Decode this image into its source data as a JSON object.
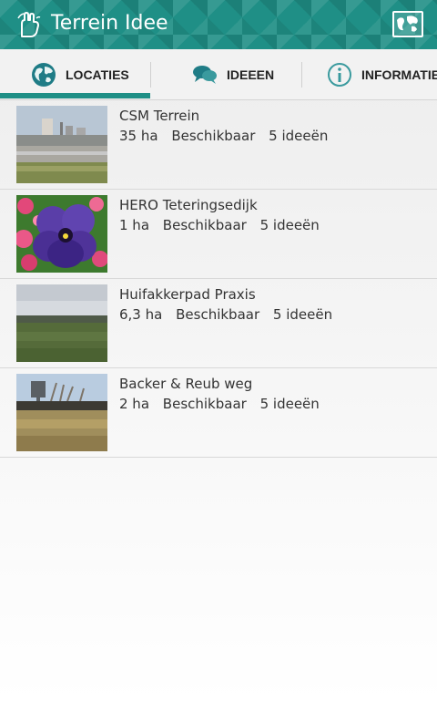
{
  "app": {
    "title": "Terrein Idee"
  },
  "icons": {
    "app": "hand-icon",
    "map": "map-icon",
    "locaties": "globe-icon",
    "ideeen": "chat-bubbles-icon",
    "informatie": "info-icon"
  },
  "tabs": [
    {
      "label": "LOCATIES",
      "active": true
    },
    {
      "label": "IDEEEN",
      "active": false
    },
    {
      "label": "INFORMATIE",
      "active": false
    }
  ],
  "locations": [
    {
      "name": "CSM Terrein",
      "size": "35 ha",
      "status": "Beschikbaar",
      "ideas": "5 ideeën"
    },
    {
      "name": "HERO Teteringsedijk",
      "size": "1 ha",
      "status": "Beschikbaar",
      "ideas": "5 ideeën"
    },
    {
      "name": "Huifakkerpad Praxis",
      "size": "6,3 ha",
      "status": "Beschikbaar",
      "ideas": "5 ideeën"
    },
    {
      "name": "Backer & Reub weg",
      "size": "2 ha",
      "status": "Beschikbaar",
      "ideas": "5 ideeën"
    }
  ],
  "colors": {
    "accent": "#1f8f86",
    "text": "#333333"
  }
}
